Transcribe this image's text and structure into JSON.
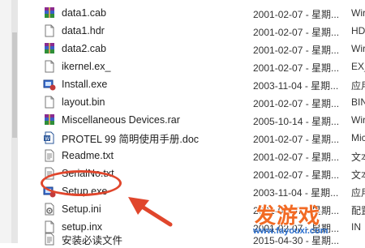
{
  "files": [
    {
      "name": "data1.cab",
      "date": "2001-02-07 - 星期...",
      "type": "Wir",
      "icon": "winrar-archive-icon"
    },
    {
      "name": "data1.hdr",
      "date": "2001-02-07 - 星期...",
      "type": "HD",
      "icon": "generic-file-icon"
    },
    {
      "name": "data2.cab",
      "date": "2001-02-07 - 星期...",
      "type": "Wir",
      "icon": "winrar-archive-icon"
    },
    {
      "name": "ikernel.ex_",
      "date": "2001-02-07 - 星期...",
      "type": "EX_",
      "icon": "generic-file-icon"
    },
    {
      "name": "Install.exe",
      "date": "2003-11-04 - 星期...",
      "type": "应用",
      "icon": "installer-exe-icon"
    },
    {
      "name": "layout.bin",
      "date": "2001-02-07 - 星期...",
      "type": "BIN",
      "icon": "generic-file-icon"
    },
    {
      "name": "Miscellaneous Devices.rar",
      "date": "2005-10-14 - 星期...",
      "type": "Wir",
      "icon": "winrar-archive-icon"
    },
    {
      "name": "PROTEL 99 简明使用手册.doc",
      "date": "2001-02-07 - 星期...",
      "type": "Mic",
      "icon": "word-document-icon"
    },
    {
      "name": "Readme.txt",
      "date": "2001-02-07 - 星期...",
      "type": "文本",
      "icon": "text-file-icon"
    },
    {
      "name": "SerialNo.txt",
      "date": "2001-02-07 - 星期...",
      "type": "文本",
      "icon": "text-file-icon"
    },
    {
      "name": "Setup.exe",
      "date": "2003-11-04 - 星期...",
      "type": "应用",
      "icon": "installer-exe-icon"
    },
    {
      "name": "Setup.ini",
      "date": "2001-02-07 - 星期...",
      "type": "配置",
      "icon": "settings-file-icon"
    },
    {
      "name": "setup.inx",
      "date": "2001-02-07 - 星期...",
      "type": "IN",
      "icon": "generic-file-icon"
    },
    {
      "name": "安装必读文件",
      "date": "2015-04-30 - 星期...",
      "type": "",
      "icon": "text-file-icon"
    }
  ],
  "watermark": {
    "logo": "发游戏",
    "url": "www.fayouxi.com"
  },
  "colors": {
    "annotation": "#e0462c",
    "watermark_logo": "#f26a24",
    "watermark_url": "#2a6fcf"
  }
}
